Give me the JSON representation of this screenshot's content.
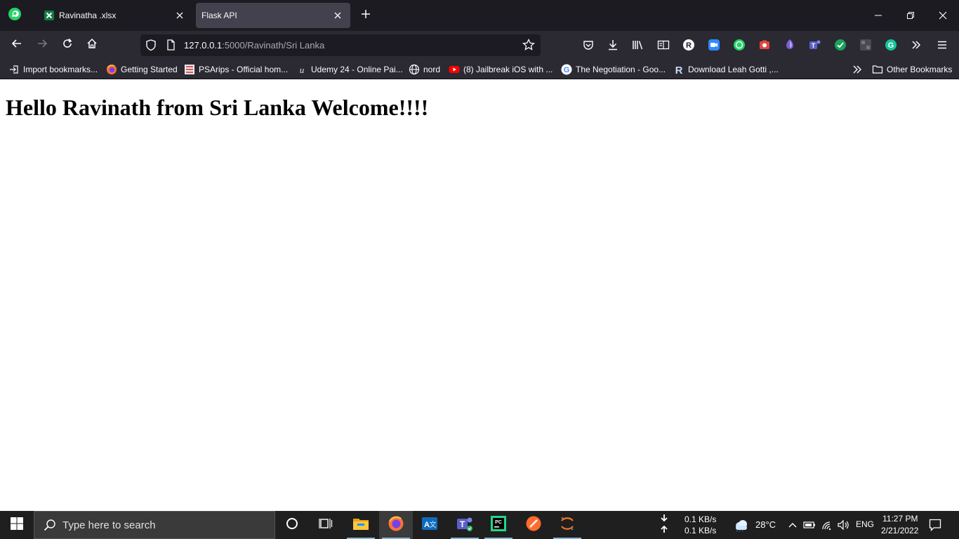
{
  "browser": {
    "tabs": [
      {
        "title": "Ravinatha .xlsx",
        "favicon": "excel-icon",
        "active": false
      },
      {
        "title": "Flask API",
        "active": true
      }
    ],
    "url_host": "127.0.0.1",
    "url_rest": ":5000/Ravinath/Sri Lanka",
    "bookmarks": [
      {
        "label": "Import bookmarks...",
        "icon": "import-icon"
      },
      {
        "label": "Getting Started",
        "icon": "firefox-icon"
      },
      {
        "label": "PSArips - Official hom...",
        "icon": "psarips-icon"
      },
      {
        "label": "Udemy 24 - Online Pai...",
        "icon": "udemy-icon"
      },
      {
        "label": "nord",
        "icon": "globe-icon"
      },
      {
        "label": "(8) Jailbreak iOS with ...",
        "icon": "youtube-icon"
      },
      {
        "label": "The Negotiation - Goo...",
        "icon": "google-icon"
      },
      {
        "label": "Download Leah Gotti ,...",
        "icon": "r-icon"
      },
      {
        "label": "Other Bookmarks",
        "icon": "folder-icon"
      }
    ]
  },
  "page": {
    "heading": "Hello Ravinath from Sri Lanka Welcome!!!!"
  },
  "taskbar": {
    "search_placeholder": "Type here to search",
    "net_down": "0.1 KB/s",
    "net_up": "0.1 KB/s",
    "temperature": "28°C",
    "language": "ENG",
    "time": "11:27 PM",
    "date": "2/21/2022"
  },
  "colors": {
    "tabstrip": "#1c1b22",
    "toolbar": "#2b2a33",
    "active_tab": "#42414d",
    "taskbar": "#1f1f1f"
  }
}
